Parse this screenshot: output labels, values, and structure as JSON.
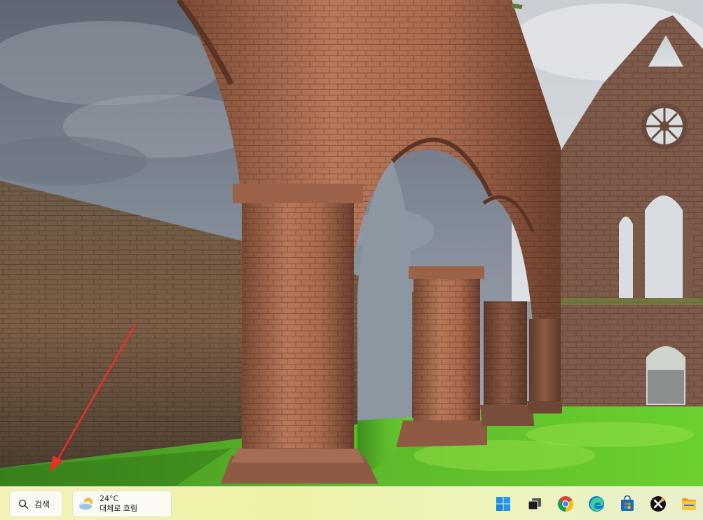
{
  "taskbar": {
    "search_label": "검색",
    "weather": {
      "temperature": "24°C",
      "condition": "대체로 흐림",
      "icon": "partly-cloudy-icon"
    },
    "pinned_apps": [
      {
        "name": "start-button",
        "icon": "windows-logo-icon"
      },
      {
        "name": "task-view-button",
        "icon": "task-view-icon"
      },
      {
        "name": "chrome-button",
        "icon": "chrome-icon"
      },
      {
        "name": "edge-button",
        "icon": "edge-icon"
      },
      {
        "name": "store-button",
        "icon": "microsoft-store-icon"
      },
      {
        "name": "x-app-button",
        "icon": "x-app-icon"
      },
      {
        "name": "file-explorer-button",
        "icon": "folder-icon"
      }
    ]
  },
  "colors": {
    "taskbar_bg": "#eef2a6",
    "arrow": "#e8302b",
    "windows_blue": "#1f8fe8"
  }
}
